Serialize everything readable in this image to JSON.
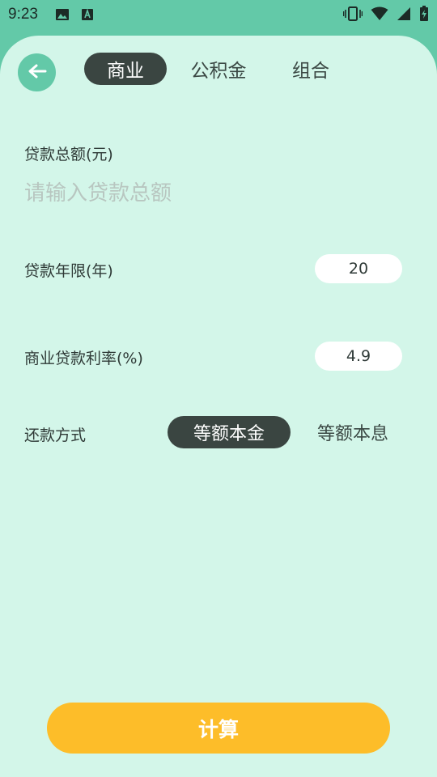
{
  "status_bar": {
    "time": "9:23",
    "left_icons": [
      "image-icon",
      "text-a-icon"
    ],
    "right_icons": [
      "vibrate-icon",
      "wifi-icon",
      "signal-icon",
      "battery-charging-icon"
    ]
  },
  "header": {
    "back_icon": "arrow-left-icon",
    "tabs": [
      {
        "label": "商业",
        "active": true
      },
      {
        "label": "公积金",
        "active": false
      },
      {
        "label": "组合",
        "active": false
      }
    ]
  },
  "form": {
    "loan_amount": {
      "label": "贷款总额(元)",
      "placeholder": "请输入贷款总额",
      "value": ""
    },
    "loan_years": {
      "label": "贷款年限(年)",
      "value": "20"
    },
    "interest_rate": {
      "label": "商业贷款利率(%)",
      "value": "4.9"
    },
    "repayment": {
      "label": "还款方式",
      "options": [
        {
          "label": "等额本金",
          "selected": true
        },
        {
          "label": "等额本息",
          "selected": false
        }
      ]
    }
  },
  "calculate_button": {
    "label": "计算"
  },
  "colors": {
    "status_bar_bg": "#63c9a8",
    "page_bg": "#d3f6e9",
    "active_pill": "#3a4541",
    "button": "#fdbd29"
  }
}
